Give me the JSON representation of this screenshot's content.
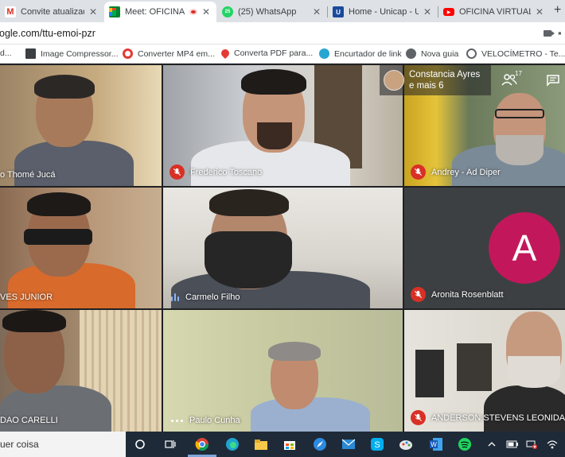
{
  "browser": {
    "tabs": [
      {
        "title": "Convite atualizado: C",
        "icon": "gmail-icon",
        "active": false
      },
      {
        "title": "Meet: OFICINA V",
        "icon": "meet-icon",
        "active": true,
        "recording": true
      },
      {
        "title": "(25) WhatsApp",
        "icon": "whatsapp-icon",
        "active": false
      },
      {
        "title": "Home - Unicap - Un",
        "icon": "unicap-icon",
        "active": false
      },
      {
        "title": "OFICINA VIRTUAL IN",
        "icon": "youtube-icon",
        "active": false
      }
    ],
    "new_tab": "+",
    "url": "ogle.com/ttu-emoi-pzr",
    "bookmarks": [
      {
        "label": "d...",
        "icon": "bookmark-icon"
      },
      {
        "label": "Image Compressor...",
        "icon": "image-icon"
      },
      {
        "label": "Converter MP4 em...",
        "icon": "convert-icon"
      },
      {
        "label": "Converta PDF para...",
        "icon": "heart-icon"
      },
      {
        "label": "Encurtador de link",
        "icon": "link-icon"
      },
      {
        "label": "Nova guia",
        "icon": "globe-icon"
      },
      {
        "label": "VELOCÍMETRO - Te...",
        "icon": "speedometer-icon"
      }
    ]
  },
  "meet": {
    "overlay": {
      "name": "Constancia Ayres",
      "more": "e mais 6"
    },
    "participant_count": "17",
    "tiles": [
      {
        "name": "o Thomé Jucá",
        "status": "none"
      },
      {
        "name": "Frederico Toscano",
        "status": "muted"
      },
      {
        "name": "Andrey - Ad Diper",
        "status": "muted"
      },
      {
        "name": "VES JUNIOR",
        "status": "none"
      },
      {
        "name": "Carmelo Filho",
        "status": "speaking"
      },
      {
        "name": "Aronita Rosenblatt",
        "status": "muted",
        "avatar_letter": "A"
      },
      {
        "name": "DAO CARELLI",
        "status": "none"
      },
      {
        "name": "Paulo Cunha",
        "status": "dots"
      },
      {
        "name": "ANDERSON STEVENS LEONIDAS G",
        "status": "muted"
      }
    ],
    "colors": {
      "muted": "#d93025",
      "avatar": "#c2185b",
      "speaking": "#8ab4f8"
    }
  },
  "taskbar": {
    "search_text": "uer coisa",
    "icons": [
      "cortana-icon",
      "task-view-icon",
      "chrome-icon",
      "edge-icon",
      "file-explorer-icon",
      "store-icon",
      "safari-like-icon",
      "mail-icon",
      "skype-icon",
      "paint-icon",
      "word-icon",
      "spotify-icon",
      "chevron-up-icon",
      "battery-icon",
      "network-icon",
      "wifi-icon"
    ]
  }
}
